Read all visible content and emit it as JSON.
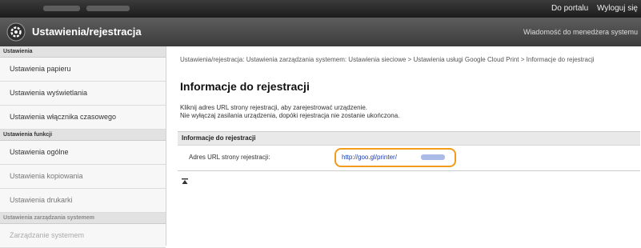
{
  "topbar": {
    "links": [
      "Do portalu",
      "Wyloguj się"
    ]
  },
  "titlebar": {
    "title": "Ustawienia/rejestracja",
    "message_link": "Wiadomość do menedżera systemu"
  },
  "sidebar": {
    "groups": [
      {
        "heading": "Ustawienia",
        "items": [
          "Ustawienia papieru",
          "Ustawienia wyświetlania",
          "Ustawienia włącznika czasowego"
        ]
      },
      {
        "heading": "Ustawienia funkcji",
        "items": [
          "Ustawienia ogólne",
          "Ustawienia kopiowania",
          "Ustawienia drukarki"
        ]
      },
      {
        "heading": "Ustawienia zarządzania systemem",
        "items": [
          "Zarządzanie systemem"
        ]
      }
    ]
  },
  "main": {
    "breadcrumb": "Ustawienia/rejestracja: Ustawienia zarządzania systemem: Ustawienia sieciowe > Ustawienia usługi Google Cloud Print > Informacje do rejestracji",
    "heading": "Informacje do rejestracji",
    "desc_line1": "Kliknij adres URL strony rejestracji, aby zarejestrować urządzenie.",
    "desc_line2": "Nie wyłączaj zasilania urządzenia, dopóki rejestracja nie zostanie ukończona.",
    "panel_title": "Informacje do rejestracji",
    "url_label": "Adres URL strony rejestracji:",
    "url_value": "http://goo.gl/printer/"
  }
}
